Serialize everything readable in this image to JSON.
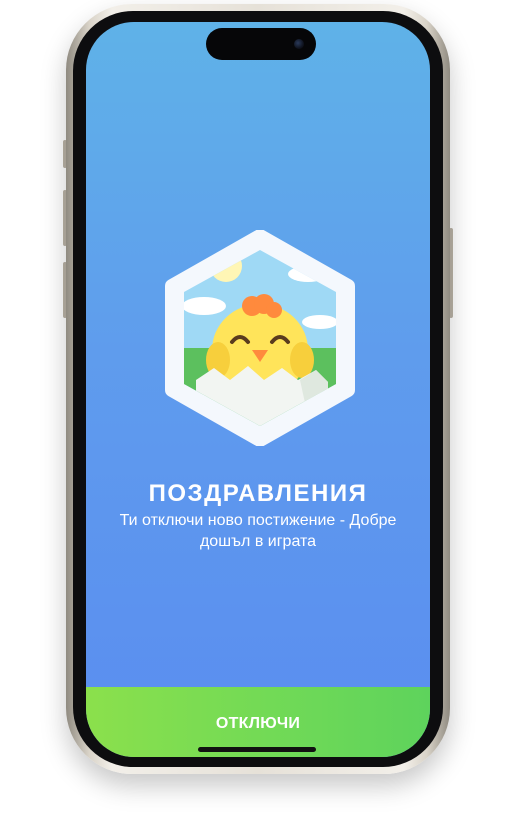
{
  "screen": {
    "background_top": "#5fb2e8",
    "background_bottom": "#5a8df0"
  },
  "badge": {
    "icon": "chick-hatching-egg-icon",
    "frame_color": "#f4f8fd",
    "sky_color": "#9fd9f5",
    "grass_color": "#5cc05e",
    "chick_color": "#ffe45a",
    "comb_color": "#ff8a3d",
    "egg_color": "#f2f5f2"
  },
  "achievement": {
    "title": "ПОЗДРАВЛЕНИЯ",
    "message": "Ти отключи ново постижение - Добре дошъл в играта"
  },
  "action": {
    "label": "ОТКЛЮЧИ",
    "color": "#7bdc52"
  }
}
